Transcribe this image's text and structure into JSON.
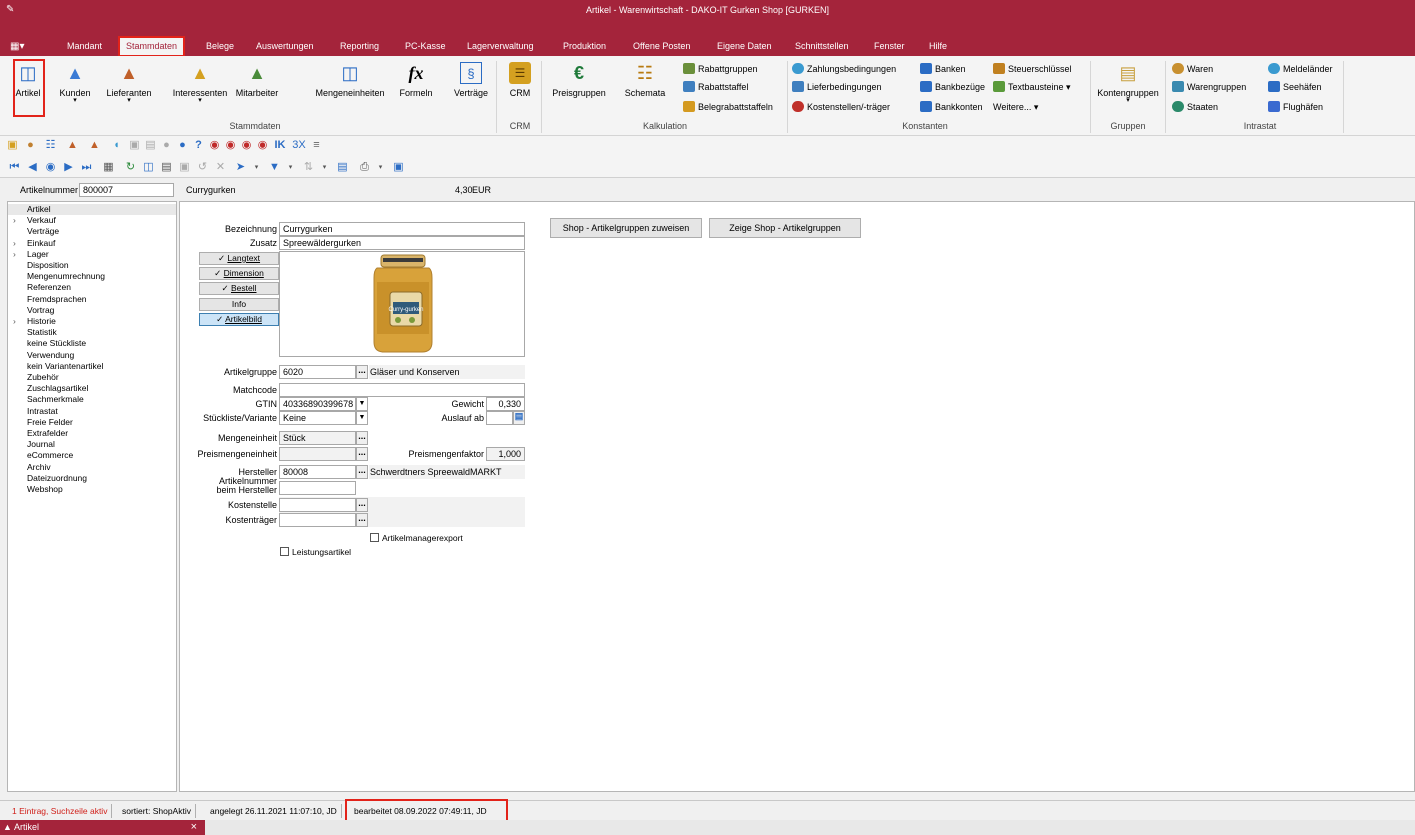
{
  "window": {
    "title": "Artikel - Warenwirtschaft - DAKO-IT Gurken Shop [GURKEN]"
  },
  "menu": {
    "items": [
      "Mandant",
      "Stammdaten",
      "Belege",
      "Auswertungen",
      "Reporting",
      "PC-Kasse",
      "Lagerverwaltung",
      "Produktion",
      "Offene Posten",
      "Eigene Daten",
      "Schnittstellen",
      "Fenster",
      "Hilfe"
    ],
    "active": "Stammdaten"
  },
  "ribbon": {
    "stammdaten": {
      "artikel": "Artikel",
      "kunden": "Kunden",
      "lieferanten": "Lieferanten",
      "interessenten": "Interessenten",
      "mitarbeiter": "Mitarbeiter",
      "mengeneinheiten": "Mengeneinheiten",
      "formeln": "Formeln",
      "vertraege": "Verträge",
      "group": "Stammdaten"
    },
    "crm": {
      "crm": "CRM",
      "group": "CRM"
    },
    "kalkulation": {
      "preisgruppen": "Preisgruppen",
      "schemata": "Schemata",
      "rabattgruppen": "Rabattgruppen",
      "rabattstaffel": "Rabattstaffel",
      "belegrabattstaffeln": "Belegrabattstaffeln",
      "group": "Kalkulation"
    },
    "konstanten": {
      "zahlungsbedingungen": "Zahlungsbedingungen",
      "lieferbedingungen": "Lieferbedingungen",
      "kostenstellen": "Kostenstellen/-träger",
      "banken": "Banken",
      "bankbezuege": "Bankbezüge",
      "bankkonten": "Bankkonten",
      "steuerschluessel": "Steuerschlüssel",
      "textbausteine": "Textbausteine",
      "weitere": "Weitere...",
      "group": "Konstanten"
    },
    "gruppen": {
      "kontengruppen": "Kontengruppen",
      "group": "Gruppen"
    },
    "intrastat": {
      "waren": "Waren",
      "warengruppen": "Warengruppen",
      "staaten": "Staaten",
      "meldelaender": "Meldeländer",
      "seehaefen": "Seehäfen",
      "flughaefen": "Flughäfen",
      "group": "Intrastat"
    }
  },
  "infobar": {
    "label": "Artikelnummer",
    "number": "800007",
    "name": "Currygurken",
    "price": "4,30",
    "currency": "EUR"
  },
  "tree": [
    {
      "label": "Artikel",
      "arrow": false
    },
    {
      "label": "Verkauf",
      "arrow": true
    },
    {
      "label": "Verträge",
      "arrow": false
    },
    {
      "label": "Einkauf",
      "arrow": true
    },
    {
      "label": "Lager",
      "arrow": true
    },
    {
      "label": "Disposition",
      "arrow": false
    },
    {
      "label": "Mengenumrechnung",
      "arrow": false
    },
    {
      "label": "Referenzen",
      "arrow": false
    },
    {
      "label": "Fremdsprachen",
      "arrow": false
    },
    {
      "label": "Vortrag",
      "arrow": false
    },
    {
      "label": "Historie",
      "arrow": true
    },
    {
      "label": "Statistik",
      "arrow": false
    },
    {
      "label": "keine Stückliste",
      "arrow": false
    },
    {
      "label": "Verwendung",
      "arrow": false
    },
    {
      "label": "kein Variantenartikel",
      "arrow": false
    },
    {
      "label": "Zubehör",
      "arrow": false
    },
    {
      "label": "Zuschlagsartikel",
      "arrow": false
    },
    {
      "label": "Sachmerkmale",
      "arrow": false
    },
    {
      "label": "Intrastat",
      "arrow": false
    },
    {
      "label": "Freie Felder",
      "arrow": false
    },
    {
      "label": "Extrafelder",
      "arrow": false
    },
    {
      "label": "Journal",
      "arrow": false
    },
    {
      "label": "eCommerce",
      "arrow": false
    },
    {
      "label": "Archiv",
      "arrow": false
    },
    {
      "label": "Dateizuordnung",
      "arrow": false
    },
    {
      "label": "Webshop",
      "arrow": false
    }
  ],
  "form": {
    "bezeichnung_label": "Bezeichnung",
    "bezeichnung": "Currygurken",
    "zusatz_label": "Zusatz",
    "zusatz": "Spreewäldergurken",
    "toggles": {
      "langtext": "Langtext",
      "dimension": "Dimension",
      "bestell": "Bestell",
      "info": "Info",
      "artikelbild": "Artikelbild"
    },
    "artikelgruppe_label": "Artikelgruppe",
    "artikelgruppe": "6020",
    "artikelgruppe_name": "Gläser und Konserven",
    "matchcode_label": "Matchcode",
    "matchcode": "",
    "gtin_label": "GTIN",
    "gtin": "40336890399678",
    "gewicht_label": "Gewicht",
    "gewicht": "0,330",
    "stueckliste_label": "Stückliste/Variante",
    "stueckliste": "Keine",
    "auslauf_label": "Auslauf ab",
    "auslauf": "",
    "mengeneinheit_label": "Mengeneinheit",
    "mengeneinheit": "Stück",
    "preismengeneinheit_label": "Preismengeneinheit",
    "preismengeneinheit": "",
    "preismengenfaktor_label": "Preismengenfaktor",
    "preismengenfaktor": "1,000",
    "hersteller_label": "Hersteller",
    "hersteller": "80008",
    "hersteller_name": "Schwerdtners SpreewaldMARKT",
    "artnr_hersteller_label1": "Artikelnummer",
    "artnr_hersteller_label2": "beim Hersteller",
    "artnr_hersteller": "",
    "kostenstelle_label": "Kostenstelle",
    "kostenstelle": "",
    "kostentraeger_label": "Kostenträger",
    "kostentraeger": "",
    "artikelmanagerexport": "Artikelmanagerexport",
    "leistungsartikel": "Leistungsartikel",
    "shop_assign": "Shop - Artikelgruppen zuweisen",
    "shop_show": "Zeige Shop - Artikelgruppen",
    "jar_label": "Curry-gurken"
  },
  "status": {
    "count": "1 Eintrag, Suchzeile aktiv",
    "sorted": "sortiert: ShopAktiv",
    "created": "angelegt 26.11.2021 11:07:10, JD",
    "edited": "bearbeitet 08.09.2022 07:49:11, JD"
  },
  "doctab": {
    "label": "Artikel",
    "close": "×"
  },
  "colors": {
    "brand": "#a4243b",
    "highlight": "#e2231a"
  }
}
